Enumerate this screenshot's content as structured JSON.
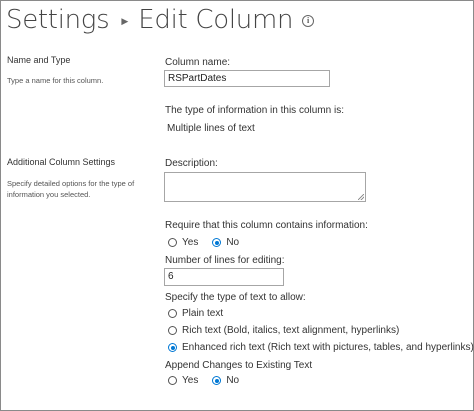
{
  "header": {
    "crumb_settings": "Settings",
    "crumb_edit_column": "Edit Column",
    "info_glyph": "i"
  },
  "name_and_type": {
    "section_title": "Name and Type",
    "section_desc": "Type a name for this column.",
    "column_name_label": "Column name:",
    "column_name_value": "RSPartDates",
    "type_info_label": "The type of information in this column is:",
    "type_value": "Multiple lines of text"
  },
  "additional": {
    "section_title": "Additional Column Settings",
    "section_desc": "Specify detailed options for the type of information you selected.",
    "description_label": "Description:",
    "description_value": "",
    "require_label": "Require that this column contains information:",
    "require_options": [
      "Yes",
      "No"
    ],
    "require_selected": "No",
    "lines_label": "Number of lines for editing:",
    "lines_value": "6",
    "text_type_label": "Specify the type of text to allow:",
    "text_type_options": [
      "Plain text",
      "Rich text (Bold, italics, text alignment, hyperlinks)",
      "Enhanced rich text (Rich text with pictures, tables, and hyperlinks)"
    ],
    "text_type_selected": "Enhanced rich text (Rich text with pictures, tables, and hyperlinks)",
    "append_label": "Append Changes to Existing Text",
    "append_options": [
      "Yes",
      "No"
    ],
    "append_selected": "No"
  },
  "colors": {
    "accent": "#0078d4",
    "text": "#333333",
    "border": "#a6a6a6"
  },
  "icons": {
    "info": "info-icon",
    "separator": "breadcrumb-separator-icon"
  }
}
